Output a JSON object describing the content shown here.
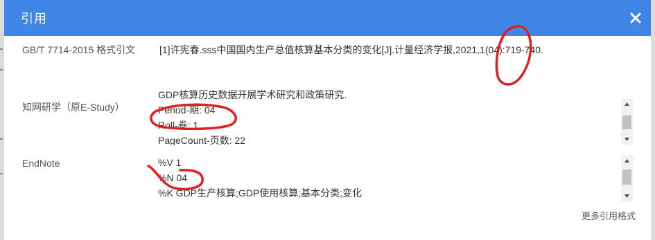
{
  "dialog": {
    "title": "引用",
    "close_icon": "close-icon"
  },
  "citations": {
    "gb": {
      "label": "GB/T 7714-2015 格式引文",
      "text": "[1]许宪春.sss中国国内生产总值核算基本分类的变化[J].计量经济学报,2021,1(04):719-740."
    },
    "estudy": {
      "label": "知网研学（原E-Study）",
      "lines": [
        "GDP核算历史数据开展学术研究和政策研究.",
        "Period-期: 04",
        "Roll-卷: 1",
        "PageCount-页数: 22"
      ]
    },
    "endnote": {
      "label": "EndNote",
      "lines": [
        "%V 1",
        "%N 04",
        "%K GDP生产核算;GDP使用核算;基本分类;变化"
      ]
    }
  },
  "more_formats_label": "更多引用格式",
  "colors": {
    "titlebar": "#3f86e6",
    "annotation": "#e02020"
  }
}
